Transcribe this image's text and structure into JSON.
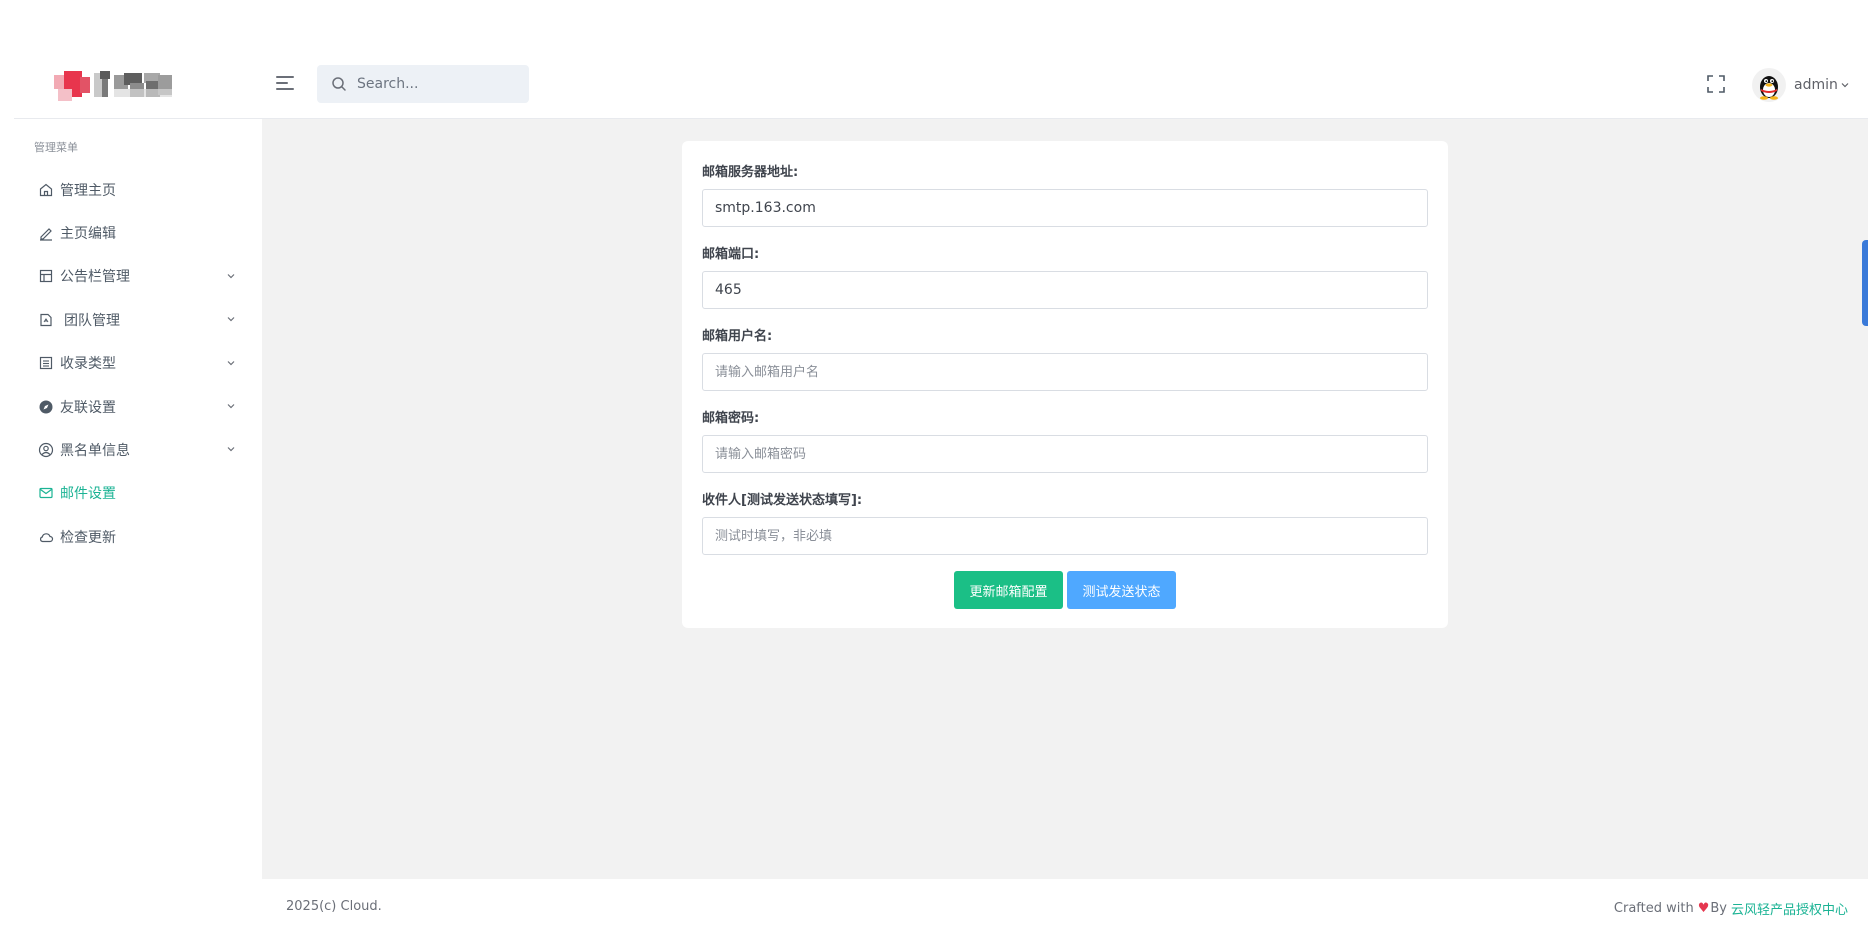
{
  "header": {
    "search_placeholder": "Search...",
    "username": "admin"
  },
  "sidebar": {
    "menu_title": "管理菜单",
    "items": [
      {
        "label": "管理主页",
        "icon": "home-icon",
        "has_submenu": false,
        "active": false
      },
      {
        "label": "主页编辑",
        "icon": "pencil-icon",
        "has_submenu": false,
        "active": false
      },
      {
        "label": "公告栏管理",
        "icon": "board-icon",
        "has_submenu": true,
        "active": false
      },
      {
        "label": "团队管理",
        "icon": "document-icon",
        "has_submenu": true,
        "active": false
      },
      {
        "label": "收录类型",
        "icon": "list-icon",
        "has_submenu": true,
        "active": false
      },
      {
        "label": "友联设置",
        "icon": "compass-icon",
        "has_submenu": true,
        "active": false
      },
      {
        "label": "黑名单信息",
        "icon": "user-circle-icon",
        "has_submenu": true,
        "active": false
      },
      {
        "label": "邮件设置",
        "icon": "mail-icon",
        "has_submenu": false,
        "active": true
      },
      {
        "label": "检查更新",
        "icon": "cloud-icon",
        "has_submenu": false,
        "active": false
      }
    ]
  },
  "form": {
    "server": {
      "label": "邮箱服务器地址:",
      "value": "smtp.163.com",
      "placeholder": ""
    },
    "port": {
      "label": "邮箱端口:",
      "value": "465",
      "placeholder": ""
    },
    "username": {
      "label": "邮箱用户名:",
      "value": "",
      "placeholder": "请输入邮箱用户名"
    },
    "password": {
      "label": "邮箱密码:",
      "value": "",
      "placeholder": "请输入邮箱密码"
    },
    "recipient": {
      "label": "收件人[测试发送状态填写]:",
      "value": "",
      "placeholder": "测试时填写，非必填"
    },
    "update_button": "更新邮箱配置",
    "test_button": "测试发送状态"
  },
  "footer": {
    "copyright": "2025(c) Cloud.",
    "crafted": "Crafted with",
    "heart": "♥",
    "by": "By",
    "link": "云风轻产品授权中心"
  },
  "colors": {
    "accent": "#1bb394",
    "update_button": "#1bbf86",
    "test_button": "#4fa8ff",
    "main_bg": "#f2f2f2"
  }
}
